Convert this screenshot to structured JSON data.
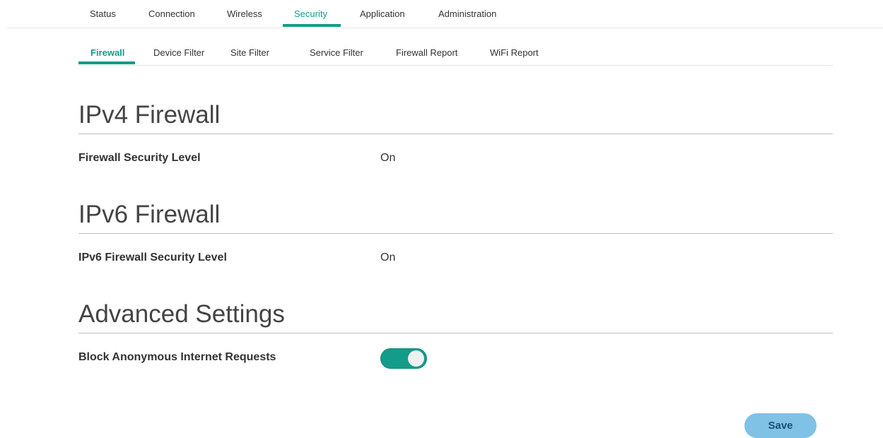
{
  "top_nav": {
    "tabs": [
      {
        "label": "Status"
      },
      {
        "label": "Connection"
      },
      {
        "label": "Wireless"
      },
      {
        "label": "Security"
      },
      {
        "label": "Application"
      },
      {
        "label": "Administration"
      }
    ],
    "active": "Security"
  },
  "sub_nav": {
    "tabs": [
      {
        "label": "Firewall"
      },
      {
        "label": "Device Filter"
      },
      {
        "label": "Site Filter"
      },
      {
        "label": "Service Filter"
      },
      {
        "label": "Firewall Report"
      },
      {
        "label": "WiFi Report"
      }
    ],
    "active": "Firewall"
  },
  "sections": {
    "ipv4": {
      "title": "IPv4 Firewall",
      "field_label": "Firewall Security Level",
      "field_value": "On"
    },
    "ipv6": {
      "title": "IPv6 Firewall",
      "field_label": "IPv6 Firewall Security Level",
      "field_value": "On"
    },
    "advanced": {
      "title": "Advanced Settings",
      "field_label": "Block Anonymous Internet Requests",
      "toggle_on": true
    }
  },
  "save_label": "Save",
  "colors": {
    "accent": "#139c89",
    "save_button": "#7fc2e6",
    "save_text": "#1c4c77"
  }
}
